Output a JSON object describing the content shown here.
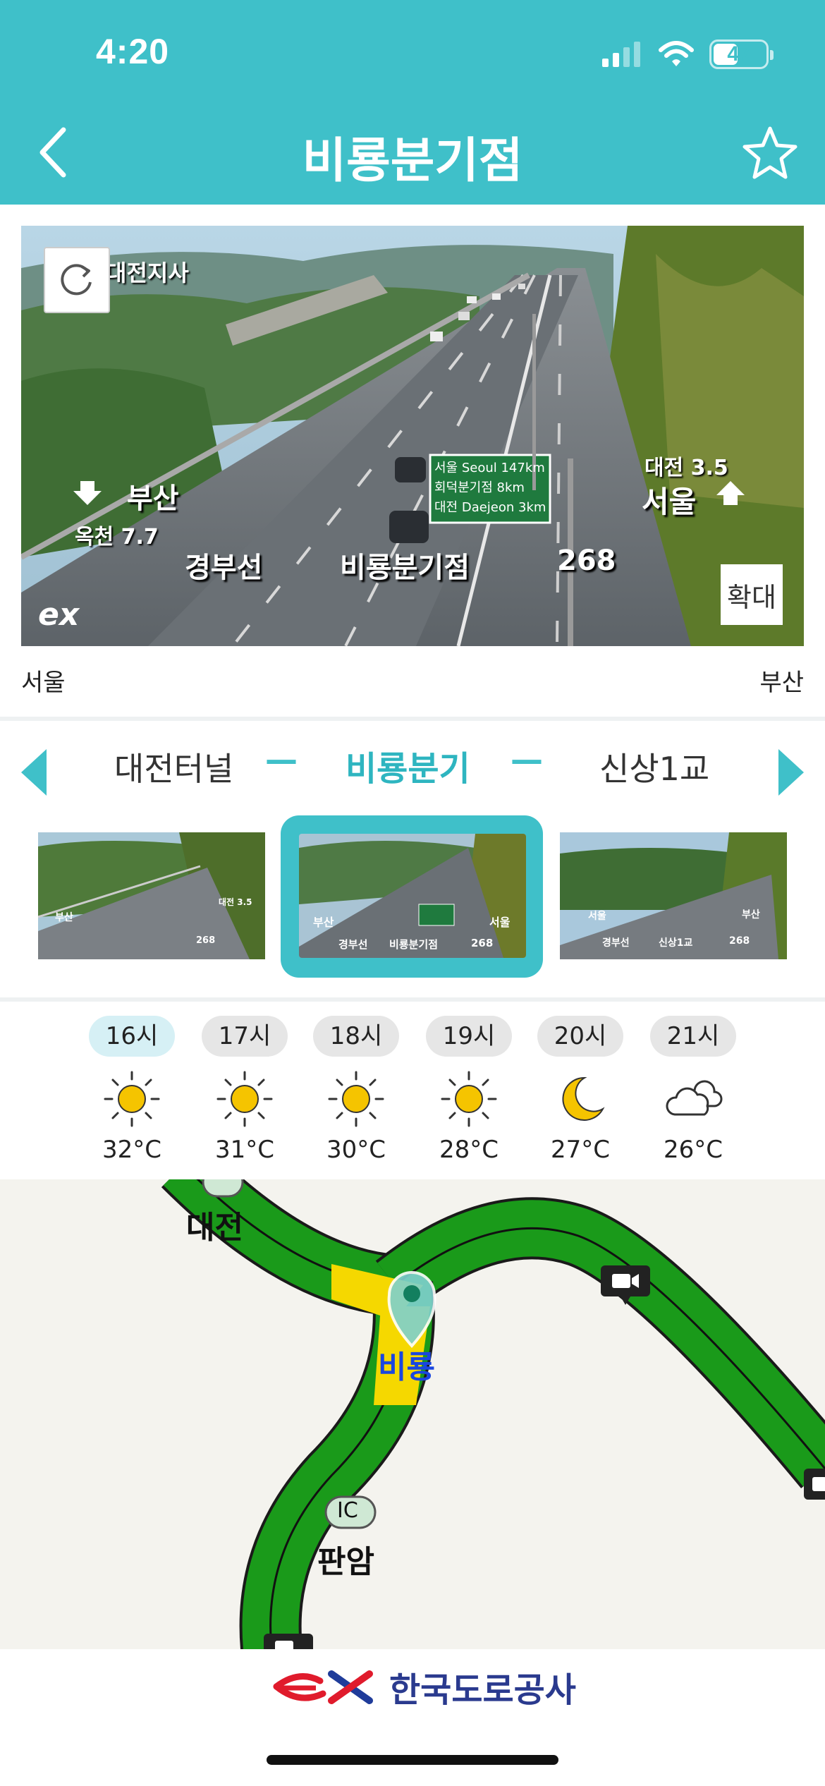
{
  "status_bar": {
    "time": "4:20",
    "battery": "47",
    "battery_level": 0.47,
    "signal_icon": "cellular-signal-icon",
    "wifi_icon": "wifi-icon"
  },
  "header": {
    "title": "비룡분기점",
    "back_icon": "chevron-left-icon",
    "favorite_icon": "star-outline-icon",
    "background_color": "#3fc0c9"
  },
  "cctv": {
    "refresh_icon": "refresh-icon",
    "zoom_label": "확대",
    "overlay": {
      "station_corner": "대전지사",
      "direction_left": "부산",
      "left_sub": "옥천 7.7",
      "route": "경부선",
      "point": "비룡분기점",
      "km": "268",
      "direction_right_top": "대전 3.5",
      "direction_right": "서울",
      "sign_line1": "서울 Seoul 147km",
      "sign_line2": "회덕분기점 8km",
      "sign_line3": "대전 Daejeon 3km",
      "logo": "ex"
    },
    "direction_start": "서울",
    "direction_end": "부산"
  },
  "location_nav": {
    "prev": "대전터널",
    "current": "비룡분기",
    "next": "신상1교",
    "separator": "—",
    "accent_color": "#3fc0c9"
  },
  "thumbnails": [
    {
      "overlay": [
        "부산",
        "대전 3.5",
        "268"
      ]
    },
    {
      "overlay": [
        "부산",
        "서울",
        "경부선",
        "비룡분기점",
        "268"
      ]
    },
    {
      "overlay": [
        "서울",
        "부산",
        "경부선",
        "신상1교",
        "268"
      ]
    }
  ],
  "weather": [
    {
      "time": "16시",
      "icon": "sun-icon",
      "temp": "32°C",
      "active": true
    },
    {
      "time": "17시",
      "icon": "sun-icon",
      "temp": "31°C"
    },
    {
      "time": "18시",
      "icon": "sun-icon",
      "temp": "30°C"
    },
    {
      "time": "19시",
      "icon": "sun-icon",
      "temp": "28°C"
    },
    {
      "time": "20시",
      "icon": "moon-icon",
      "temp": "27°C"
    },
    {
      "time": "21시",
      "icon": "cloud-icon",
      "temp": "26°C"
    }
  ],
  "map": {
    "labels": {
      "daejeon": "대전",
      "biryong": "비룡",
      "panam": "판암",
      "ic_badge": "IC"
    },
    "road_color": "#1a9a1a",
    "congestion_color": "#f5d800"
  },
  "footer": {
    "brand_logo": "ex",
    "brand_name": "한국도로공사"
  }
}
